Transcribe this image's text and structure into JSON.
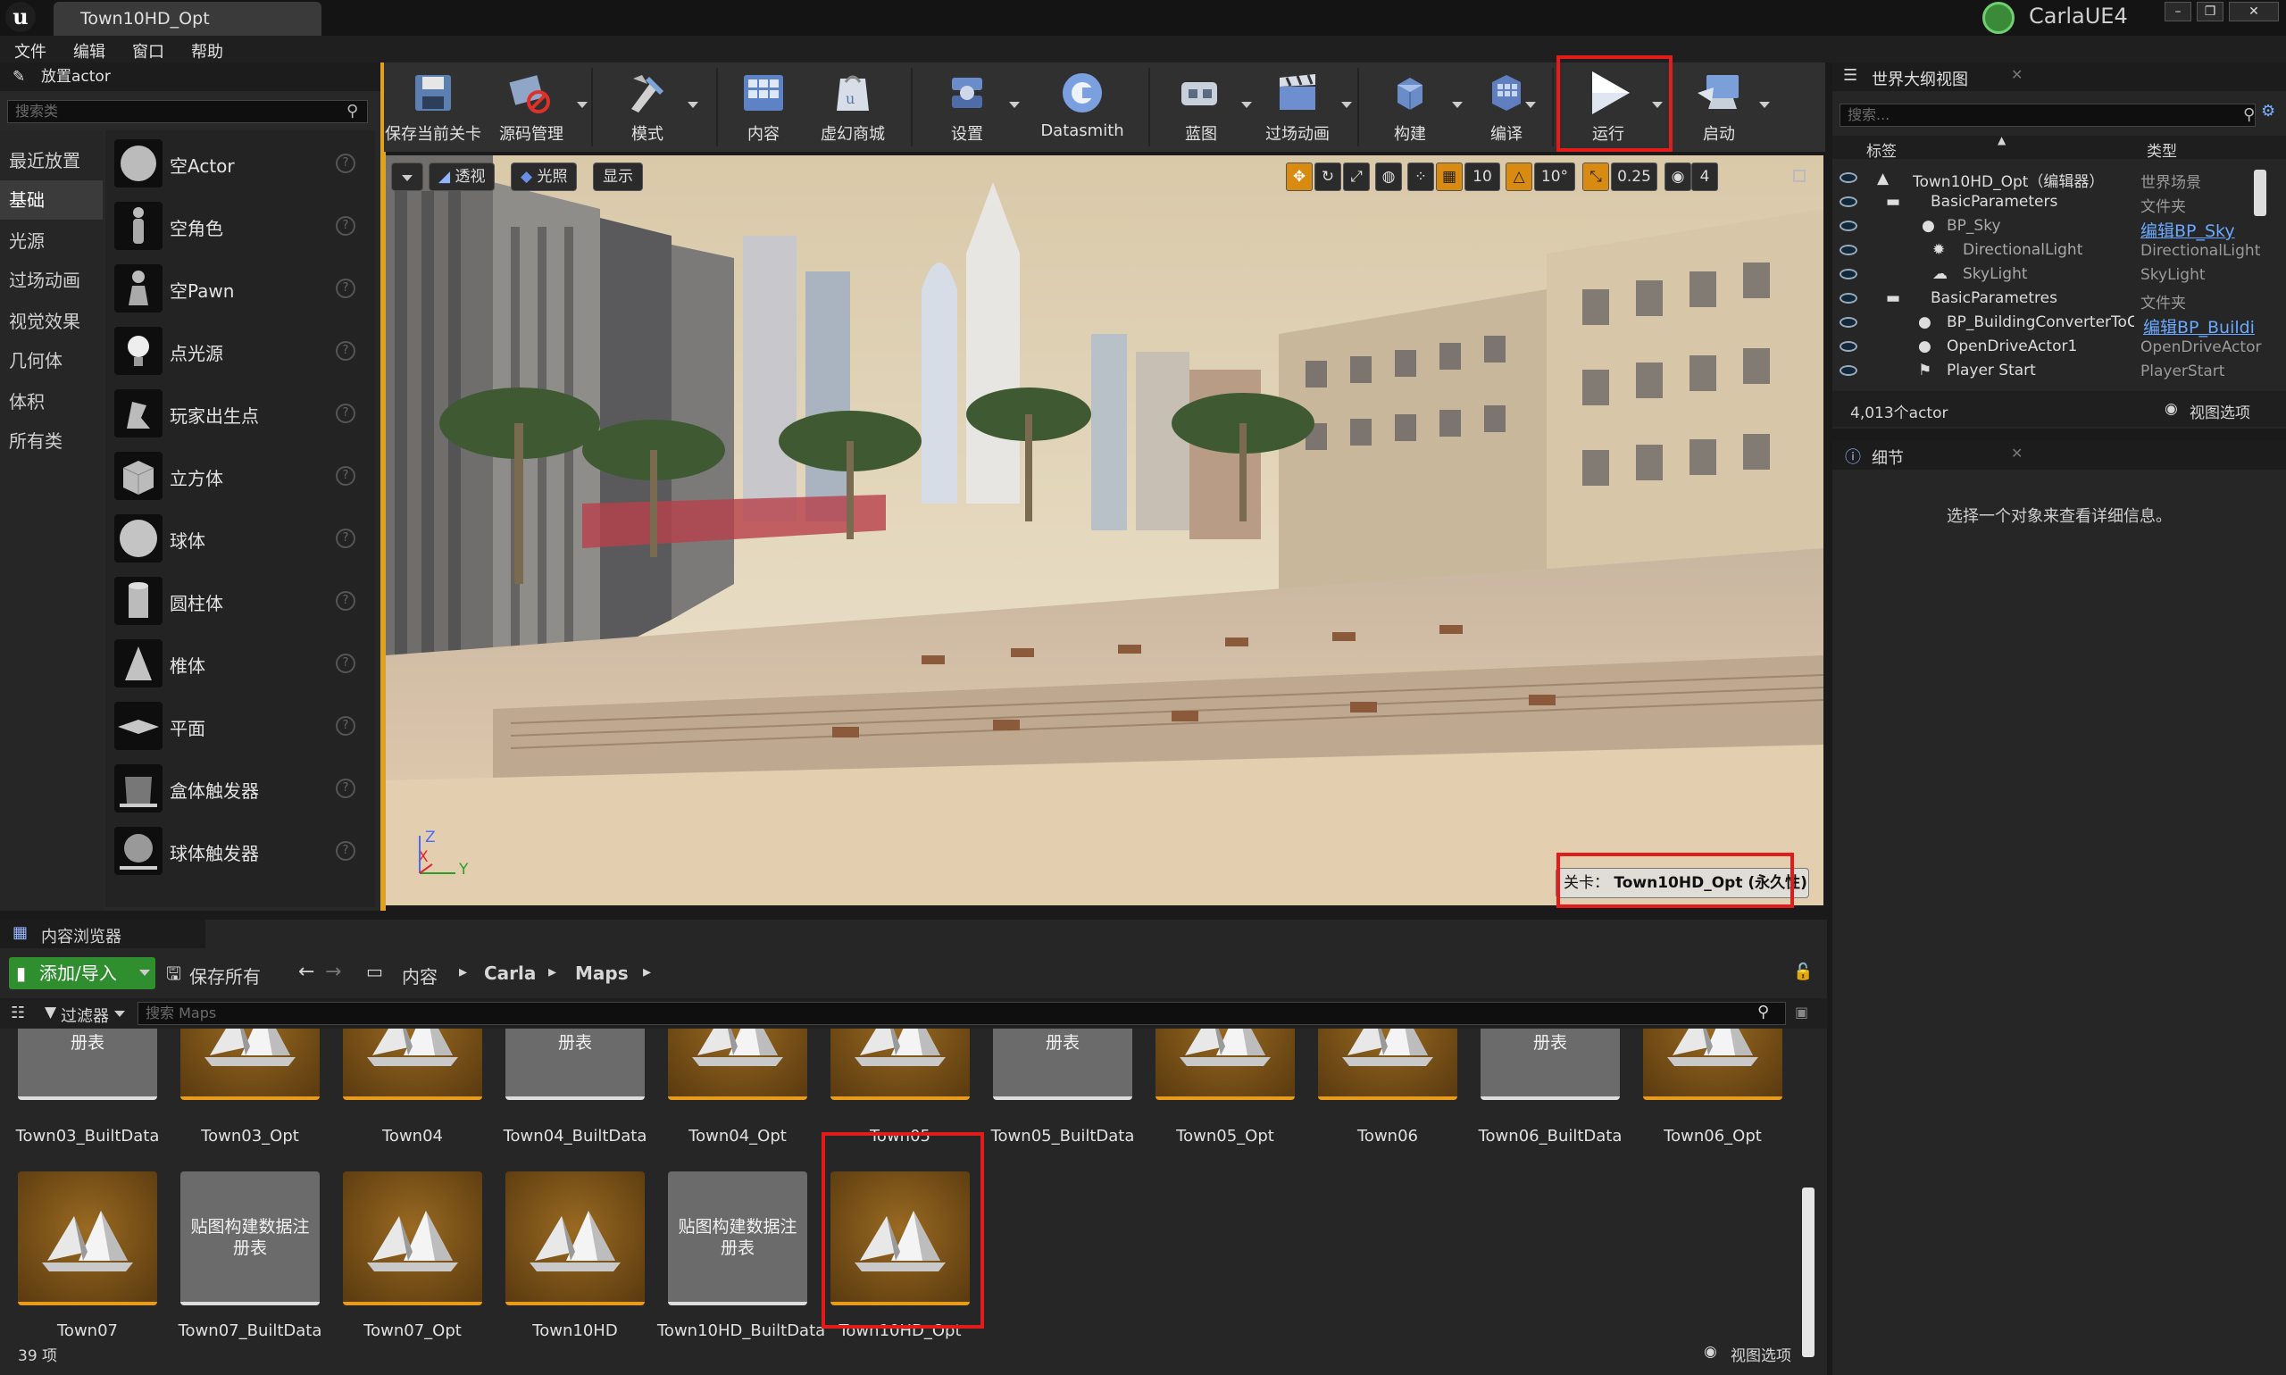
{
  "window": {
    "tab_title": "Town10HD_Opt",
    "project_name": "CarlaUE4"
  },
  "menu": [
    "文件",
    "编辑",
    "窗口",
    "帮助"
  ],
  "place_actor": {
    "title": "放置actor",
    "search_placeholder": "搜索类",
    "categories": [
      "最近放置",
      "基础",
      "光源",
      "过场动画",
      "视觉效果",
      "几何体",
      "体积",
      "所有类"
    ],
    "active_category": "基础",
    "items": [
      "空Actor",
      "空角色",
      "空Pawn",
      "点光源",
      "玩家出生点",
      "立方体",
      "球体",
      "圆柱体",
      "椎体",
      "平面",
      "盒体触发器",
      "球体触发器"
    ]
  },
  "toolbar": {
    "buttons": [
      "保存当前关卡",
      "源码管理",
      "模式",
      "内容",
      "虚幻商城",
      "设置",
      "Datasmith",
      "蓝图",
      "过场动画",
      "构建",
      "编译",
      "运行",
      "启动"
    ],
    "highlighted": "运行"
  },
  "viewport": {
    "perspective_label": "透视",
    "lighting_label": "光照",
    "show_label": "显示",
    "grid_snap": "10",
    "rotation_snap": "10°",
    "scale_snap": "0.25",
    "camera_speed": "4",
    "level_label_prefix": "关卡：",
    "level_name": "Town10HD_Opt (永久性)",
    "axis_z": "Z",
    "axis_x": "X",
    "axis_y": "Y"
  },
  "outliner": {
    "title": "世界大纲视图",
    "search_placeholder": "搜索...",
    "col_label": "标签",
    "col_type": "类型",
    "rows": [
      {
        "label": "Town10HD_Opt（编辑器）",
        "type": "世界场景",
        "link": false
      },
      {
        "label": "BasicParameters",
        "type": "文件夹",
        "link": false
      },
      {
        "label": "BP_Sky",
        "type": "编辑BP_Sky",
        "link": true
      },
      {
        "label": "DirectionalLight",
        "type": "DirectionalLight",
        "link": false
      },
      {
        "label": "SkyLight",
        "type": "SkyLight",
        "link": false
      },
      {
        "label": "BasicParametres",
        "type": "文件夹",
        "link": false
      },
      {
        "label": "BP_BuildingConverterToCo",
        "type": "编辑BP_Buildi",
        "link": true
      },
      {
        "label": "OpenDriveActor1",
        "type": "OpenDriveActor",
        "link": false
      },
      {
        "label": "Player Start",
        "type": "PlayerStart",
        "link": false
      }
    ],
    "actor_count": "4,013个actor",
    "view_options": "视图选项"
  },
  "details": {
    "title": "细节",
    "empty_message": "选择一个对象来查看详细信息。"
  },
  "content_browser": {
    "title": "内容浏览器",
    "add_import": "添加/导入",
    "save_all": "保存所有",
    "path": [
      "内容",
      "Carla",
      "Maps"
    ],
    "filters": "过滤器",
    "search_placeholder": "搜索 Maps",
    "data_thumb_text": "贴图构建数据注册表",
    "row1": [
      {
        "name": "Town03_BuiltData",
        "kind": "data"
      },
      {
        "name": "Town03_Opt",
        "kind": "map"
      },
      {
        "name": "Town04",
        "kind": "map"
      },
      {
        "name": "Town04_BuiltData",
        "kind": "data"
      },
      {
        "name": "Town04_Opt",
        "kind": "map"
      },
      {
        "name": "Town05",
        "kind": "map"
      },
      {
        "name": "Town05_BuiltData",
        "kind": "data"
      },
      {
        "name": "Town05_Opt",
        "kind": "map"
      },
      {
        "name": "Town06",
        "kind": "map"
      },
      {
        "name": "Town06_BuiltData",
        "kind": "data"
      },
      {
        "name": "Town06_Opt",
        "kind": "map"
      }
    ],
    "row2": [
      {
        "name": "Town07",
        "kind": "map"
      },
      {
        "name": "Town07_BuiltData",
        "kind": "data"
      },
      {
        "name": "Town07_Opt",
        "kind": "map"
      },
      {
        "name": "Town10HD",
        "kind": "map"
      },
      {
        "name": "Town10HD_BuiltData",
        "kind": "data"
      },
      {
        "name": "Town10HD_Opt",
        "kind": "map"
      }
    ],
    "selected_asset": "Town10HD_Opt",
    "item_count": "39 项",
    "view_options": "视图选项"
  },
  "colors": {
    "highlight": "#e21b1b",
    "map_asset_border": "#e89a1a",
    "add_button": "#2f8f2f",
    "link": "#6aa8ff"
  }
}
